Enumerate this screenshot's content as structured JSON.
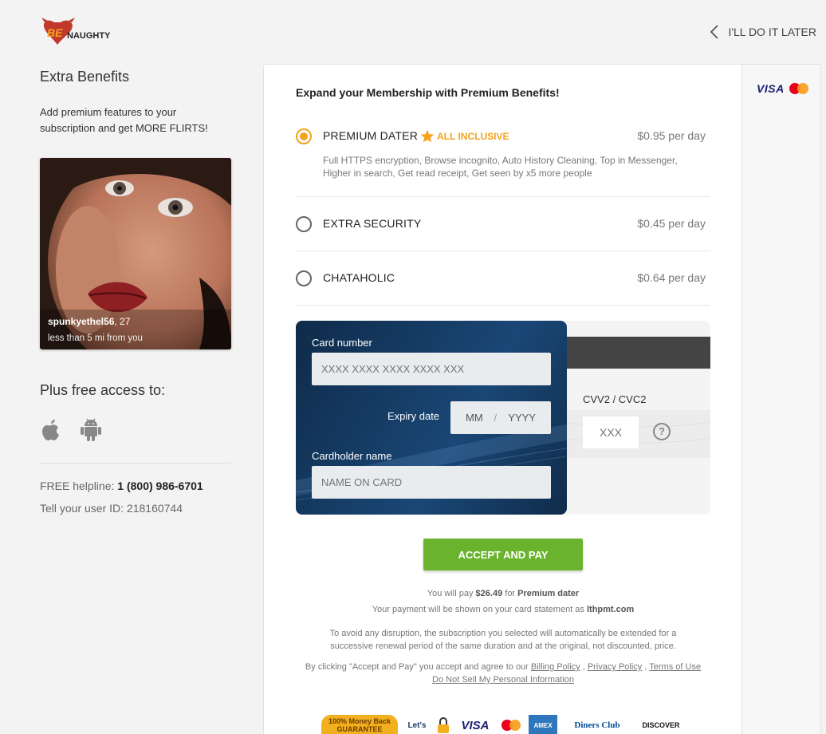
{
  "header": {
    "logo_text": "BE NAUGHTY",
    "later_label": "I'LL DO IT LATER"
  },
  "left": {
    "title": "Extra Benefits",
    "description": "Add premium features to your subscription and get MORE FLIRTS!",
    "profile": {
      "username": "spunkyethel56",
      "age": ", 27",
      "distance": "less than 5 mi from you"
    },
    "free_access_title": "Plus free access to:",
    "helpline_label": "FREE helpline: ",
    "helpline_number": "1 (800) 986-6701",
    "user_id_text": "Tell your user ID: 218160744"
  },
  "main": {
    "title": "Expand your Membership with Premium Benefits!",
    "plans": [
      {
        "name": "PREMIUM DATER",
        "badge": "ALL INCLUSIVE",
        "price": "$0.95 per day",
        "selected": true,
        "description": "Full HTTPS encryption, Browse incognito, Auto History Cleaning, Top in Messenger, Higher in search, Get read receipt, Get seen by x5 more people"
      },
      {
        "name": "EXTRA SECURITY",
        "price": "$0.45 per day",
        "selected": false
      },
      {
        "name": "CHATAHOLIC",
        "price": "$0.64 per day",
        "selected": false
      }
    ],
    "card": {
      "number_label": "Card number",
      "number_placeholder": "XXXX XXXX XXXX XXXX XXX",
      "expiry_label": "Expiry date",
      "expiry_month": "MM",
      "expiry_sep": "/",
      "expiry_year": "YYYY",
      "holder_label": "Cardholder name",
      "holder_placeholder": "NAME ON CARD",
      "cvv_label": "CVV2 / CVC2",
      "cvv_placeholder": "XXX",
      "help_glyph": "?"
    },
    "pay_button": "ACCEPT AND PAY",
    "summary": {
      "pay_prefix": "You will pay ",
      "amount": "$26.49",
      "pay_for": " for ",
      "plan": "Premium dater",
      "statement_prefix": "Your payment will be shown on your card statement as ",
      "statement_name": "lthpmt.com"
    },
    "renewal_text": "To avoid any disruption, the subscription you selected will automatically be extended for a successive renewal period of the same duration and at the original, not discounted, price.",
    "terms_prefix": "By clicking \"Accept and Pay\" you accept and agree to our ",
    "billing_policy": "Billing Policy",
    "privacy_policy": "Privacy Policy",
    "terms_of_use": "Terms of Use",
    "sep_comma": " , ",
    "do_not_sell": "Do Not Sell My Personal Information",
    "trust_logos": {
      "guarantee_top": "100% Money Back",
      "guarantee": "GUARANTEE",
      "letsencrypt": "Let's",
      "visa": "VISA",
      "amex": "AMEX",
      "diners": "Diners Club",
      "discover": "DISCOVER"
    }
  },
  "sidebar": {
    "visa": "VISA"
  },
  "colors": {
    "accent": "#f4a21b",
    "pay_button": "#6ab42d",
    "card": "#17406b"
  }
}
